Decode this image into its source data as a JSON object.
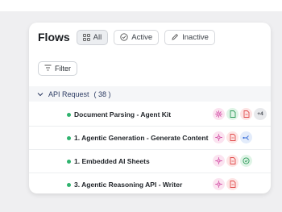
{
  "header": {
    "title": "Flows",
    "tabs": [
      {
        "label": "All",
        "icon": "grid-icon",
        "selected": true
      },
      {
        "label": "Active",
        "icon": "check-circle-icon",
        "selected": false
      },
      {
        "label": "Inactive",
        "icon": "pencil-icon",
        "selected": false
      }
    ]
  },
  "toolbar": {
    "filter_label": "Filter",
    "filter_icon": "filter-lines-icon"
  },
  "group": {
    "label": "API Request",
    "count": "( 38 )",
    "icon": "chevron-down-icon"
  },
  "rows": [
    {
      "name": "Document Parsing - Agent Kit",
      "status": "active",
      "icons": [
        "agent-icon",
        "document-icon",
        "pdf-icon"
      ],
      "more": "+4"
    },
    {
      "name": "1. Agentic Generation - Generate Content",
      "status": "active",
      "icons": [
        "agent-icon",
        "pdf-icon",
        "branch-icon"
      ]
    },
    {
      "name": "1. Embedded AI Sheets",
      "status": "active",
      "icons": [
        "agent-icon",
        "pdf-icon",
        "sheet-icon"
      ]
    },
    {
      "name": "3. Agentic Reasoning API - Writer",
      "status": "active",
      "icons": [
        "agent-icon",
        "pdf-icon"
      ]
    }
  ],
  "colors": {
    "status_active": "#2fb36e",
    "agent_icon": "#d24aa4",
    "pdf_icon": "#e14b4b",
    "document_icon": "#2e9a5a",
    "branch_icon": "#3b6fd8"
  }
}
